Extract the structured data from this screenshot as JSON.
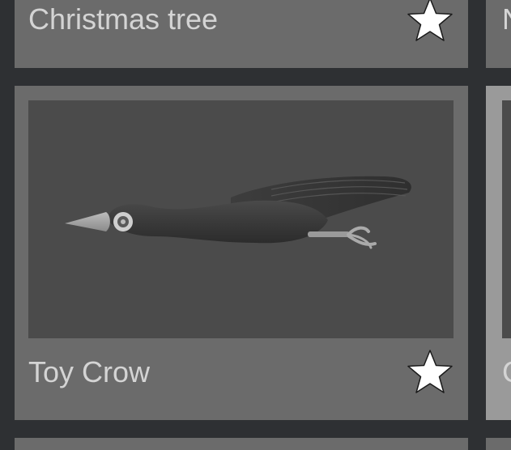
{
  "cards": [
    {
      "title": "Christmas tree",
      "favorite_icon": "star-outline-icon"
    },
    {
      "title": "Toy Crow",
      "favorite_icon": "star-outline-icon",
      "thumbnail": "toy-crow-3d-model-preview"
    }
  ],
  "right_column": {
    "top_partial_text": "N",
    "bottom_partial_text": "C"
  },
  "colors": {
    "page_background": "#2e3033",
    "card_background": "#6b6b6b",
    "thumbnail_background": "#4b4b4b",
    "selected_card_background": "#9a9a9a",
    "title_text": "#d4d4d4",
    "star_fill": "#ffffff"
  }
}
